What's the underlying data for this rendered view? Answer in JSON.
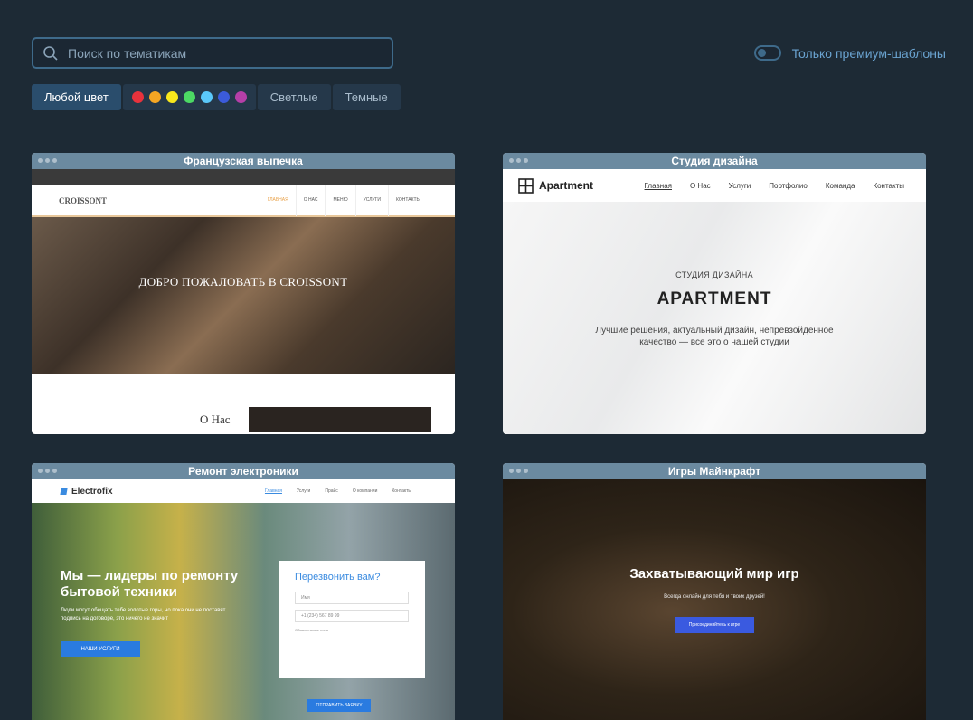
{
  "search": {
    "placeholder": "Поиск по тематикам"
  },
  "premium_toggle": {
    "label": "Только премиум-шаблоны"
  },
  "filters": {
    "any_color": "Любой цвет",
    "colors": [
      "#e8323c",
      "#f5a623",
      "#f8e71c",
      "#4cd964",
      "#5ac8fa",
      "#3b5bdb",
      "#b63fa8"
    ],
    "light": "Светлые",
    "dark": "Темные"
  },
  "templates": [
    {
      "title": "Французская выпечка",
      "logo": "CROISSONT",
      "menu": [
        "ГЛАВНАЯ",
        "О НАС",
        "МЕНЮ",
        "УСЛУГИ",
        "КОНТАКТЫ"
      ],
      "hero_title": "ДОБРО ПОЖАЛОВАТЬ В CROISSONT",
      "about": "О Нас"
    },
    {
      "title": "Студия дизайна",
      "logo": "Apartment",
      "menu": [
        "Главная",
        "О Нас",
        "Услуги",
        "Портфолио",
        "Команда",
        "Контакты"
      ],
      "hero_kicker": "СТУДИЯ ДИЗАЙНА",
      "hero_title": "APARTMENT",
      "hero_text": "Лучшие решения, актуальный дизайн, непревзойденное качество — все это о нашей студии"
    },
    {
      "title": "Ремонт электроники",
      "logo": "Electrofix",
      "menu": [
        "Главная",
        "Услуги",
        "Прайс",
        "О компании",
        "Контакты"
      ],
      "hero_title": "Мы — лидеры по ремонту бытовой техники",
      "hero_text": "Люди могут обещать тебе золотые горы, но пока они не поставят подпись на договоре, это ничего не значит",
      "hero_button": "НАШИ УСЛУГИ",
      "form_title": "Перезвонить вам?",
      "form_name": "Имя",
      "form_phone": "+1 (234) 567 89 99",
      "form_note": "Обязательные поля",
      "form_button": "ОТПРАВИТЬ ЗАЯВКУ"
    },
    {
      "title": "Игры Майнкрафт",
      "hero_title": "Захватывающий мир игр",
      "hero_text": "Всегда онлайн для тебя и твоих друзей!",
      "hero_button": "Присоединяйтесь к игре"
    }
  ]
}
